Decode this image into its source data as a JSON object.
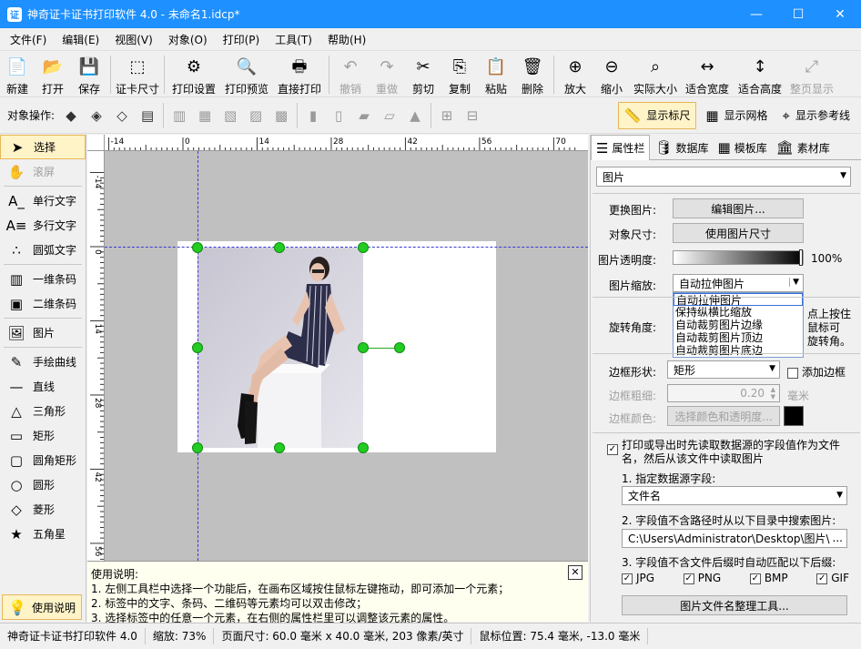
{
  "window": {
    "title": "神奇证卡证书打印软件 4.0 - 未命名1.idcp*",
    "min": "—",
    "max": "☐",
    "close": "✕"
  },
  "menu": [
    "文件(F)",
    "编辑(E)",
    "视图(V)",
    "对象(O)",
    "打印(P)",
    "工具(T)",
    "帮助(H)"
  ],
  "toolbar": [
    {
      "label": "新建",
      "icon": "📄",
      "name": "new"
    },
    {
      "label": "打开",
      "icon": "📂",
      "name": "open"
    },
    {
      "label": "保存",
      "icon": "💾",
      "name": "save"
    },
    {
      "sep": true
    },
    {
      "label": "证卡尺寸",
      "icon": "⬚",
      "name": "card-size"
    },
    {
      "sep": true
    },
    {
      "label": "打印设置",
      "icon": "⚙",
      "name": "print-settings"
    },
    {
      "label": "打印预览",
      "icon": "🔍",
      "name": "print-preview"
    },
    {
      "label": "直接打印",
      "icon": "🖶",
      "name": "print"
    },
    {
      "sep": true
    },
    {
      "label": "撤销",
      "icon": "↶",
      "name": "undo",
      "disabled": true
    },
    {
      "label": "重做",
      "icon": "↷",
      "name": "redo",
      "disabled": true
    },
    {
      "label": "剪切",
      "icon": "✂",
      "name": "cut"
    },
    {
      "label": "复制",
      "icon": "⎘",
      "name": "copy"
    },
    {
      "label": "粘贴",
      "icon": "📋",
      "name": "paste"
    },
    {
      "label": "删除",
      "icon": "🗑",
      "name": "delete"
    },
    {
      "sep": true
    },
    {
      "label": "放大",
      "icon": "⊕",
      "name": "zoom-in"
    },
    {
      "label": "缩小",
      "icon": "⊖",
      "name": "zoom-out"
    },
    {
      "label": "实际大小",
      "icon": "⌕",
      "name": "actual-size"
    },
    {
      "label": "适合宽度",
      "icon": "↔",
      "name": "fit-width"
    },
    {
      "label": "适合高度",
      "icon": "↕",
      "name": "fit-height"
    },
    {
      "label": "整页显示",
      "icon": "⤢",
      "name": "fit-page",
      "disabled": true
    }
  ],
  "objbar": {
    "label": "对象操作:",
    "icons": [
      "◆",
      "◈",
      "◇",
      "▤",
      "|",
      "▥",
      "▦",
      "▧",
      "▨",
      "▩",
      "|",
      "▮",
      "▯",
      "▰",
      "▱",
      "▲",
      "|",
      "⊞",
      "⊟"
    ],
    "toggles": [
      {
        "label": "显示标尺",
        "icon": "📏",
        "active": true
      },
      {
        "label": "显示网格",
        "icon": "▦",
        "active": false
      },
      {
        "label": "显示参考线",
        "icon": "⌖",
        "active": false
      }
    ]
  },
  "lefttools": [
    {
      "label": "选择",
      "icon": "➤",
      "active": true
    },
    {
      "label": "滚屏",
      "icon": "✋",
      "disabled": true
    },
    {
      "sep": true
    },
    {
      "label": "单行文字",
      "icon": "A_"
    },
    {
      "label": "多行文字",
      "icon": "A≡"
    },
    {
      "label": "圆弧文字",
      "icon": "∴"
    },
    {
      "sep": true
    },
    {
      "label": "一维条码",
      "icon": "▥"
    },
    {
      "label": "二维条码",
      "icon": "▣"
    },
    {
      "sep": true
    },
    {
      "label": "图片",
      "icon": "🖼"
    },
    {
      "sep": true
    },
    {
      "label": "手绘曲线",
      "icon": "✎"
    },
    {
      "label": "直线",
      "icon": "—"
    },
    {
      "label": "三角形",
      "icon": "△"
    },
    {
      "label": "矩形",
      "icon": "▭"
    },
    {
      "label": "圆角矩形",
      "icon": "▢"
    },
    {
      "label": "圆形",
      "icon": "○"
    },
    {
      "label": "菱形",
      "icon": "◇"
    },
    {
      "label": "五角星",
      "icon": "★"
    }
  ],
  "help_button": {
    "label": "使用说明",
    "icon": "💡"
  },
  "ruler": {
    "h_labels": [
      "-14",
      "0",
      "14",
      "28",
      "42",
      "56",
      "70"
    ],
    "v_labels": [
      "-14",
      "0",
      "14",
      "28",
      "42",
      "56"
    ]
  },
  "help_panel": {
    "title": "使用说明:",
    "lines": [
      "1. 左侧工具栏中选择一个功能后，在画布区域按住鼠标左键拖动，即可添加一个元素；",
      "2. 标签中的文字、条码、二维码等元素均可以双击修改；",
      "3. 选择标签中的任意一个元素，在右侧的属性栏里可以调整该元素的属性。"
    ],
    "close": "✕"
  },
  "rightpanel": {
    "tabs": [
      {
        "label": "属性栏",
        "icon": "☰"
      },
      {
        "label": "数据库",
        "icon": "🛢"
      },
      {
        "label": "模板库",
        "icon": "▦"
      },
      {
        "label": "素材库",
        "icon": "🏛"
      }
    ],
    "object_type": "图片",
    "change_image_label": "更换图片:",
    "edit_image_btn": "编辑图片...",
    "obj_size_label": "对象尺寸:",
    "use_size_btn": "使用图片尺寸",
    "opacity_label": "图片透明度:",
    "opacity_value": "100%",
    "opacity_fraction": 1.0,
    "scale_label": "图片缩放:",
    "scale_value": "自动拉伸图片",
    "scale_options": [
      "自动拉伸图片",
      "保持纵横比缩放",
      "自动裁剪图片边缘",
      "自动裁剪图片顶边",
      "自动裁剪图片底边"
    ],
    "rotate_label": "旋转角度:",
    "rotate_hint": [
      "点上按住",
      "鼠标可",
      "旋转角。"
    ],
    "border_shape_label": "边框形状:",
    "border_shape": "矩形",
    "add_border": "添加边框",
    "border_width_label": "边框粗细:",
    "border_width": "0.20",
    "border_unit": "毫米",
    "border_color_label": "边框颜色:",
    "border_color_btn": "选择颜色和透明度...",
    "datasource_check": "打印或导出时先读取数据源的字段值作为文件名，然后从该文件中读取图片",
    "step1": "1. 指定数据源字段:",
    "field_value": "文件名",
    "step2": "2. 字段值不含路径时从以下目录中搜索图片:",
    "path_value": "C:\\Users\\Administrator\\Desktop\\图片\\",
    "path_btn": "...",
    "step3": "3. 字段值不含文件后缀时自动匹配以下后缀:",
    "exts": [
      "JPG",
      "PNG",
      "BMP",
      "GIF"
    ],
    "tool_btn": "图片文件名整理工具..."
  },
  "status": [
    "神奇证卡证书打印软件 4.0",
    "缩放: 73%",
    "页面尺寸: 60.0 毫米 x 40.0 毫米, 203 像素/英寸",
    "鼠标位置: 75.4 毫米, -13.0 毫米"
  ]
}
